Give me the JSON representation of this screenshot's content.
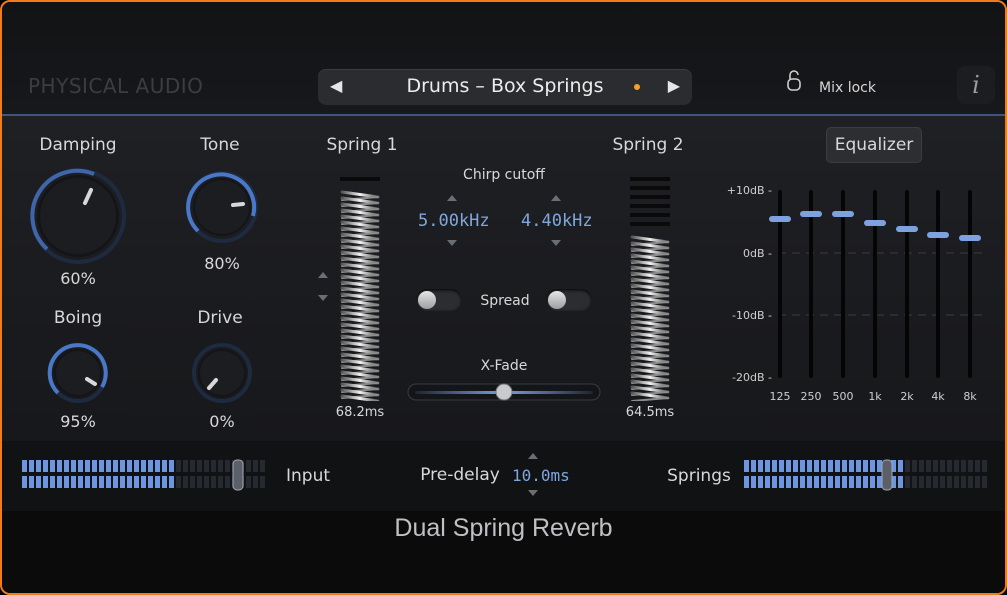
{
  "brand": "PHYSICAL AUDIO",
  "preset": {
    "name": "Drums – Box Springs",
    "prev_icon": "◀",
    "next_icon": "▶"
  },
  "mixlock": {
    "label": "Mix lock"
  },
  "info_label": "i",
  "knobs": {
    "damping": {
      "label": "Damping",
      "value": "60%"
    },
    "tone": {
      "label": "Tone",
      "value": "80%"
    },
    "boing": {
      "label": "Boing",
      "value": "95%"
    },
    "drive": {
      "label": "Drive",
      "value": "0%"
    }
  },
  "spring1": {
    "label": "Spring 1",
    "time": "68.2ms"
  },
  "spring2": {
    "label": "Spring 2",
    "time": "64.5ms"
  },
  "chirp": {
    "label": "Chirp cutoff",
    "left": "5.00kHz",
    "right": "4.40kHz"
  },
  "spread": {
    "label": "Spread"
  },
  "xfade": {
    "label": "X-Fade"
  },
  "equalizer": {
    "button": "Equalizer",
    "db_labels": [
      "+10dB -",
      "0dB -",
      "-10dB -",
      "-20dB -"
    ],
    "bands": [
      "125",
      "250",
      "500",
      "1k",
      "2k",
      "4k",
      "8k"
    ]
  },
  "input": {
    "label": "Input"
  },
  "predelay": {
    "label": "Pre-delay",
    "value": "10.0ms"
  },
  "springs": {
    "label": "Springs"
  },
  "product_title": "Dual Spring Reverb",
  "colors": {
    "accent": "#7fa6dd",
    "frame": "#f07c1a",
    "preset_dot": "#f2a12c"
  }
}
